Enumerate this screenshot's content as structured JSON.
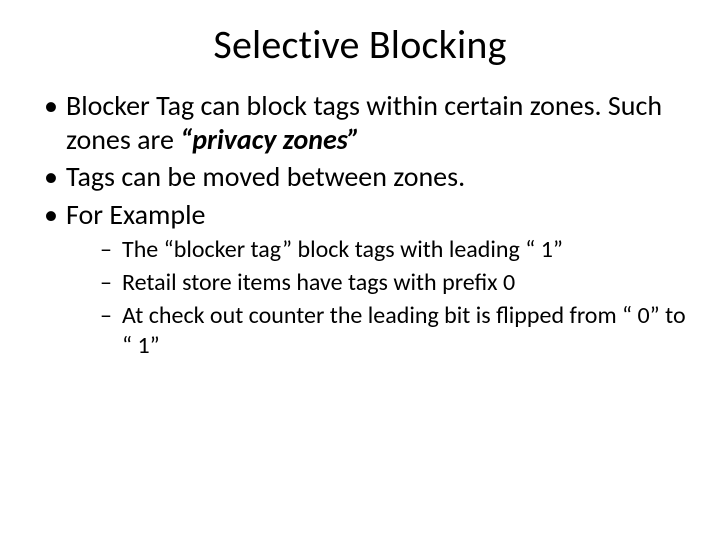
{
  "title": "Selective Blocking",
  "bullets": {
    "b1_pre": "Blocker Tag can block tags within certain zones. Such zones are ",
    "b1_em": "“privacy zones”",
    "b2": "Tags can be moved between zones.",
    "b3": "For Example",
    "sub": {
      "s1": "The “blocker tag” block tags with leading “ 1”",
      "s2": "Retail store items have tags with prefix 0",
      "s3": "At check out counter the leading bit is flipped from “ 0” to “ 1”"
    }
  }
}
